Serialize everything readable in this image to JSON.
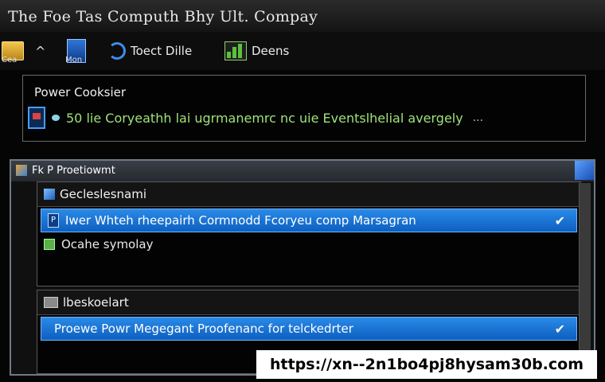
{
  "titlebar": {
    "title": "The Foe Tas Computh Bhy Ult. Compay"
  },
  "toolbar": {
    "items": [
      {
        "label": "Toect Dille",
        "icon": "refresh-icon"
      },
      {
        "label": "Deens",
        "icon": "chart-icon"
      }
    ],
    "left_sublabel": "Cea",
    "mid_sublabel": "Mon"
  },
  "panel": {
    "label": "Power Cooksier",
    "row_text": "50 lie Coryeathh lai ugrmanemrc nc uie Eventslhelial avergely",
    "row_tail": "..."
  },
  "window": {
    "title": "Fk P Proetiowmt",
    "group1": {
      "title": "Gecleslesnami",
      "selected_row": "Iwer Whteh rheepairh Cormnodd Fcoryeu comp Marsagran",
      "row2": "Ocahe symolay"
    },
    "group2": {
      "title": "lbeskoelart",
      "selected_row": "Proewe Powr Megegant Proofenanc for telckedrter"
    }
  },
  "watermark_url": "https://xn--2n1bo4pj8hysam30b.com",
  "colors": {
    "selection": "#1f7fe0",
    "green_text": "#9fe37a"
  }
}
